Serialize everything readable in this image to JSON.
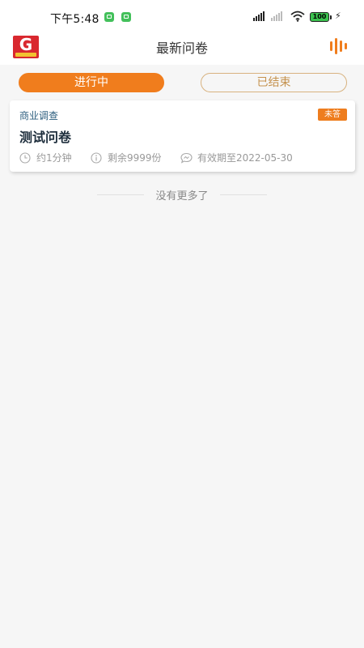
{
  "status_bar": {
    "time": "下午5:48",
    "battery": "100"
  },
  "header": {
    "title": "最新问卷",
    "logo_icon": "app-logo-icon",
    "right_icon": "audio-wave-icon"
  },
  "tabs": [
    {
      "label": "进行中",
      "active": true
    },
    {
      "label": "已结束",
      "active": false
    }
  ],
  "surveys": [
    {
      "category": "商业调查",
      "badge": "未答",
      "title": "测试问卷",
      "duration": "约1分钟",
      "remaining": "剩余9999份",
      "validity": "有效期至2022-05-30"
    }
  ],
  "footer_text": "没有更多了",
  "colors": {
    "accent": "#f07d1d",
    "inactive_tab_text": "#c5924e",
    "category_text": "#2c5e7e",
    "background": "#f6f6f6"
  }
}
